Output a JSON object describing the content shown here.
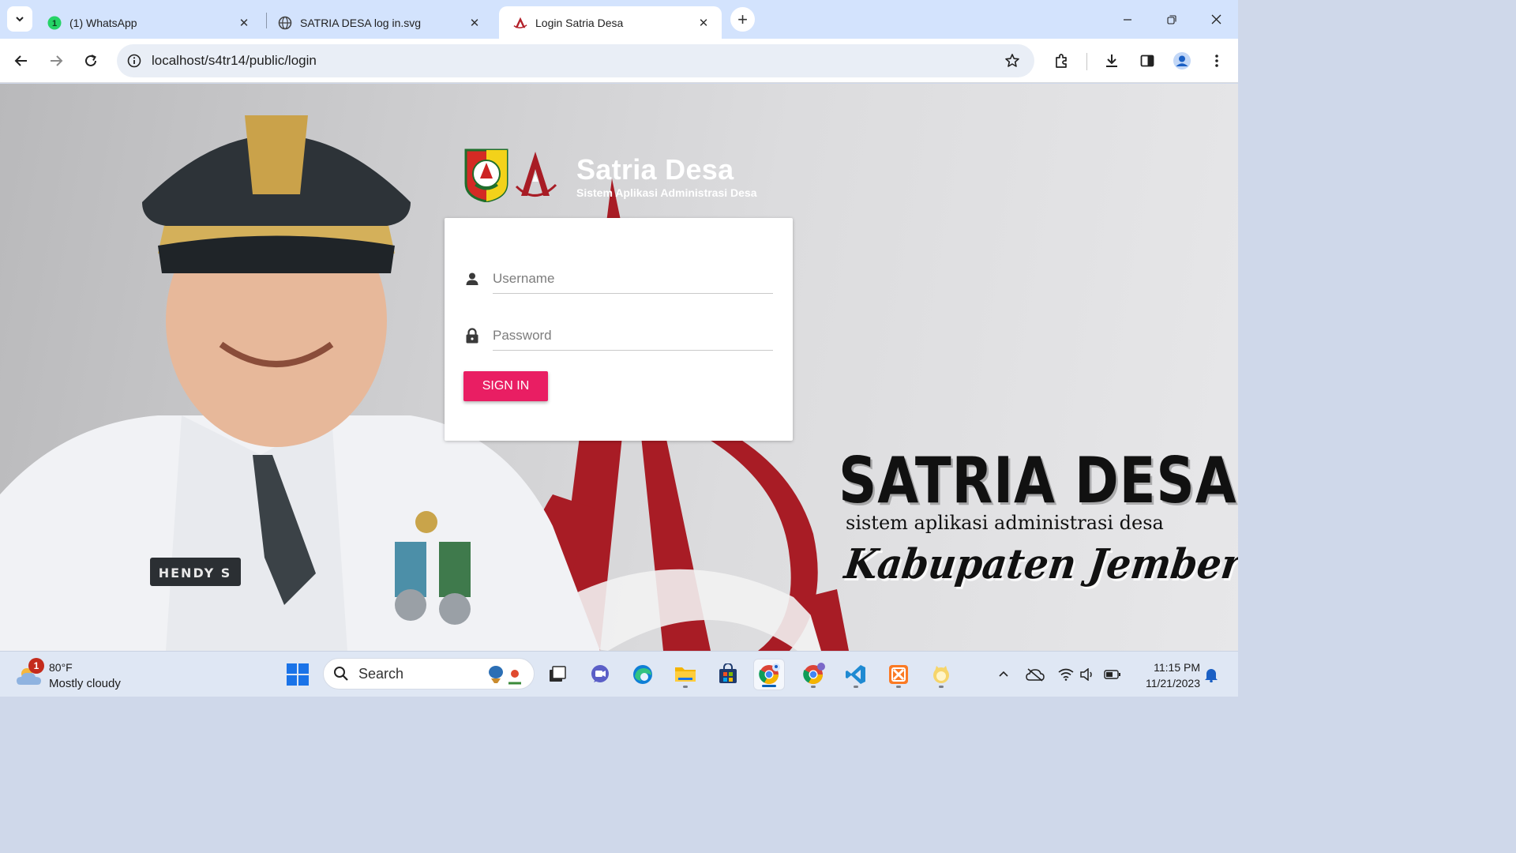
{
  "browser": {
    "tabs": [
      {
        "title": "(1) WhatsApp",
        "icon": "whatsapp-icon",
        "active": false
      },
      {
        "title": "SATRIA DESA log in.svg",
        "icon": "globe-icon",
        "active": false
      },
      {
        "title": "Login Satria Desa",
        "icon": "satria-logo-icon",
        "active": true
      }
    ],
    "url": "localhost/s4tr14/public/login"
  },
  "page": {
    "brand_title": "Satria Desa",
    "brand_subtitle": "Sistem Aplikasi Administrasi Desa",
    "form": {
      "username_placeholder": "Username",
      "password_placeholder": "Password",
      "signin_label": "SIGN IN"
    },
    "banner": {
      "title": "SATRIA DESA",
      "subtitle": "sistem aplikasi administrasi  desa",
      "region": "Kabupaten Jember"
    },
    "photo_name_tag": "HENDY S",
    "colors": {
      "accent": "#e91e63",
      "emblem_red": "#a81c25"
    }
  },
  "taskbar": {
    "weather": {
      "badge": "1",
      "temp": "80°F",
      "condition": "Mostly cloudy"
    },
    "search_label": "Search",
    "time": "11:15 PM",
    "date": "11/21/2023"
  }
}
